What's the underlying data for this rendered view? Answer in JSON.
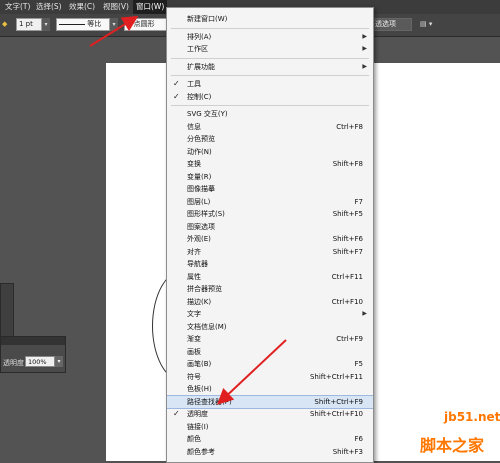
{
  "menubar": {
    "items": [
      "文字(T)",
      "选择(S)",
      "效果(C)",
      "视图(V)",
      "窗口(W)"
    ]
  },
  "control_bar": {
    "stroke_weight": "1 pt",
    "stroke_profile": "等比",
    "brush": "5 点圆形",
    "right_button": "透选项"
  },
  "left_panel": {
    "opacity_label": "透明度",
    "opacity_value": "100%"
  },
  "menu": {
    "items": [
      {
        "label": "新建窗口(W)",
        "shortcut": "",
        "checked": false,
        "submenu": false
      },
      {
        "sep": true
      },
      {
        "label": "排列(A)",
        "shortcut": "",
        "checked": false,
        "submenu": true
      },
      {
        "label": "工作区",
        "shortcut": "",
        "checked": false,
        "submenu": true
      },
      {
        "sep": true
      },
      {
        "label": "扩展功能",
        "shortcut": "",
        "checked": false,
        "submenu": true
      },
      {
        "sep": true
      },
      {
        "label": "工具",
        "shortcut": "",
        "checked": true,
        "submenu": false
      },
      {
        "label": "控制(C)",
        "shortcut": "",
        "checked": true,
        "submenu": false
      },
      {
        "sep": true
      },
      {
        "label": "SVG 交互(Y)",
        "shortcut": "",
        "checked": false,
        "submenu": false
      },
      {
        "label": "信息",
        "shortcut": "Ctrl+F8",
        "checked": false,
        "submenu": false
      },
      {
        "label": "分色预览",
        "shortcut": "",
        "checked": false,
        "submenu": false
      },
      {
        "label": "动作(N)",
        "shortcut": "",
        "checked": false,
        "submenu": false
      },
      {
        "label": "变换",
        "shortcut": "Shift+F8",
        "checked": false,
        "submenu": false
      },
      {
        "label": "变量(R)",
        "shortcut": "",
        "checked": false,
        "submenu": false
      },
      {
        "label": "图像描摹",
        "shortcut": "",
        "checked": false,
        "submenu": false
      },
      {
        "label": "图层(L)",
        "shortcut": "F7",
        "checked": false,
        "submenu": false
      },
      {
        "label": "图形样式(S)",
        "shortcut": "Shift+F5",
        "checked": false,
        "submenu": false
      },
      {
        "label": "图案选项",
        "shortcut": "",
        "checked": false,
        "submenu": false
      },
      {
        "label": "外观(E)",
        "shortcut": "Shift+F6",
        "checked": false,
        "submenu": false
      },
      {
        "label": "对齐",
        "shortcut": "Shift+F7",
        "checked": false,
        "submenu": false
      },
      {
        "label": "导航器",
        "shortcut": "",
        "checked": false,
        "submenu": false
      },
      {
        "label": "属性",
        "shortcut": "Ctrl+F11",
        "checked": false,
        "submenu": false
      },
      {
        "label": "拼合器预览",
        "shortcut": "",
        "checked": false,
        "submenu": false
      },
      {
        "label": "描边(K)",
        "shortcut": "Ctrl+F10",
        "checked": false,
        "submenu": false
      },
      {
        "label": "文字",
        "shortcut": "",
        "checked": false,
        "submenu": true
      },
      {
        "label": "文档信息(M)",
        "shortcut": "",
        "checked": false,
        "submenu": false
      },
      {
        "label": "渐变",
        "shortcut": "Ctrl+F9",
        "checked": false,
        "submenu": false
      },
      {
        "label": "画板",
        "shortcut": "",
        "checked": false,
        "submenu": false
      },
      {
        "label": "画笔(B)",
        "shortcut": "F5",
        "checked": false,
        "submenu": false
      },
      {
        "label": "符号",
        "shortcut": "Shift+Ctrl+F11",
        "checked": false,
        "submenu": false
      },
      {
        "label": "色板(H)",
        "shortcut": "",
        "checked": false,
        "submenu": false
      },
      {
        "label": "路径查找器(P)",
        "shortcut": "Shift+Ctrl+F9",
        "checked": false,
        "submenu": false,
        "highlighted": true
      },
      {
        "label": "透明度",
        "shortcut": "Shift+Ctrl+F10",
        "checked": true,
        "submenu": false
      },
      {
        "label": "链接(I)",
        "shortcut": "",
        "checked": false,
        "submenu": false
      },
      {
        "label": "颜色",
        "shortcut": "F6",
        "checked": false,
        "submenu": false
      },
      {
        "label": "颜色参考",
        "shortcut": "Shift+F3",
        "checked": false,
        "submenu": false
      }
    ]
  },
  "watermark": {
    "site": "jb51.net",
    "name": "脚本之家"
  },
  "colors": {
    "accent_arrow": "#e02020",
    "highlight": "#d8e5f5",
    "watermark": "#ff7700"
  }
}
